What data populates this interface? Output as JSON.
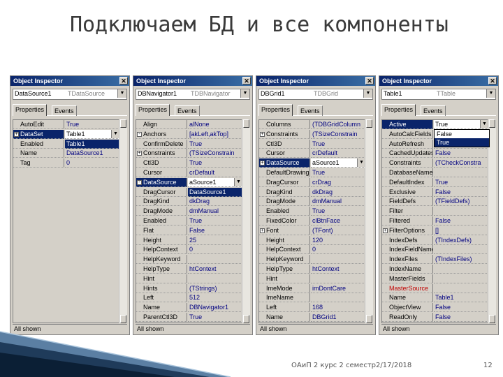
{
  "slide": {
    "title": "Подключаем БД и все компоненты",
    "footer_course": "ОАиП 2 курс 2 семестр",
    "footer_date": "2/17/2018",
    "footer_page": "12"
  },
  "inspectors": [
    {
      "title": "Object Inspector",
      "combo_name": "DataSource1",
      "combo_type": "TDataSource",
      "tab_active": "Properties",
      "tab_inactive": "Events",
      "status": "All shown",
      "rows": [
        {
          "n": "AutoEdit",
          "v": "True",
          "pm": ""
        },
        {
          "n": "DataSet",
          "v": "Table1",
          "pm": "+",
          "sel": true,
          "dd": true
        },
        {
          "n": "Enabled",
          "v": "Table1",
          "pm": "",
          "hlv": true
        },
        {
          "n": "Name",
          "v": "DataSource1",
          "pm": ""
        },
        {
          "n": "Tag",
          "v": "0",
          "pm": ""
        }
      ]
    },
    {
      "title": "Object Inspector",
      "combo_name": "DBNavigator1",
      "combo_type": "TDBNavigator",
      "tab_active": "Properties",
      "tab_inactive": "Events",
      "status": "All shown",
      "rows": [
        {
          "n": "Align",
          "v": "alNone",
          "pm": ""
        },
        {
          "n": "Anchors",
          "v": "[akLeft,akTop]",
          "pm": "-"
        },
        {
          "n": "ConfirmDelete",
          "v": "True",
          "pm": ""
        },
        {
          "n": "Constraints",
          "v": "(TSizeConstrain",
          "pm": "+"
        },
        {
          "n": "Ctl3D",
          "v": "True",
          "pm": ""
        },
        {
          "n": "Cursor",
          "v": "crDefault",
          "pm": ""
        },
        {
          "n": "DataSource",
          "v": "aSource1",
          "pm": "-",
          "sel": true,
          "dd": true
        },
        {
          "n": "DragCursor",
          "v": "DataSource1",
          "pm": "",
          "hlv": true
        },
        {
          "n": "DragKind",
          "v": "dkDrag",
          "pm": ""
        },
        {
          "n": "DragMode",
          "v": "dmManual",
          "pm": ""
        },
        {
          "n": "Enabled",
          "v": "True",
          "pm": ""
        },
        {
          "n": "Flat",
          "v": "False",
          "pm": ""
        },
        {
          "n": "Height",
          "v": "25",
          "pm": ""
        },
        {
          "n": "HelpContext",
          "v": "0",
          "pm": ""
        },
        {
          "n": "HelpKeyword",
          "v": "",
          "pm": ""
        },
        {
          "n": "HelpType",
          "v": "htContext",
          "pm": ""
        },
        {
          "n": "Hint",
          "v": "",
          "pm": ""
        },
        {
          "n": "Hints",
          "v": "(TStrings)",
          "pm": ""
        },
        {
          "n": "Left",
          "v": "512",
          "pm": ""
        },
        {
          "n": "Name",
          "v": "DBNavigator1",
          "pm": ""
        },
        {
          "n": "ParentCtl3D",
          "v": "True",
          "pm": ""
        }
      ]
    },
    {
      "title": "Object Inspector",
      "combo_name": "DBGrid1",
      "combo_type": "TDBGrid",
      "tab_active": "Properties",
      "tab_inactive": "Events",
      "status": "All shown",
      "rows": [
        {
          "n": "Columns",
          "v": "(TDBGridColumn",
          "pm": ""
        },
        {
          "n": "Constraints",
          "v": "(TSizeConstrain",
          "pm": "+"
        },
        {
          "n": "Ctl3D",
          "v": "True",
          "pm": ""
        },
        {
          "n": "Cursor",
          "v": "crDefault",
          "pm": ""
        },
        {
          "n": "DataSource",
          "v": "aSource1",
          "pm": "+",
          "sel": true,
          "dd": true
        },
        {
          "n": "DefaultDrawing",
          "v": "True",
          "pm": ""
        },
        {
          "n": "DragCursor",
          "v": "crDrag",
          "pm": ""
        },
        {
          "n": "DragKind",
          "v": "dkDrag",
          "pm": ""
        },
        {
          "n": "DragMode",
          "v": "dmManual",
          "pm": ""
        },
        {
          "n": "Enabled",
          "v": "True",
          "pm": ""
        },
        {
          "n": "FixedColor",
          "v": "clBtnFace",
          "pm": ""
        },
        {
          "n": "Font",
          "v": "(TFont)",
          "pm": "+"
        },
        {
          "n": "Height",
          "v": "120",
          "pm": ""
        },
        {
          "n": "HelpContext",
          "v": "0",
          "pm": ""
        },
        {
          "n": "HelpKeyword",
          "v": "",
          "pm": ""
        },
        {
          "n": "HelpType",
          "v": "htContext",
          "pm": ""
        },
        {
          "n": "Hint",
          "v": "",
          "pm": ""
        },
        {
          "n": "ImeMode",
          "v": "imDontCare",
          "pm": ""
        },
        {
          "n": "ImeName",
          "v": "",
          "pm": ""
        },
        {
          "n": "Left",
          "v": "168",
          "pm": ""
        },
        {
          "n": "Name",
          "v": "DBGrid1",
          "pm": ""
        }
      ]
    },
    {
      "title": "Object Inspector",
      "combo_name": "Table1",
      "combo_type": "TTable",
      "tab_active": "Properties",
      "tab_inactive": "Events",
      "status": "All shown",
      "dropdown": [
        "False",
        "True"
      ],
      "rows": [
        {
          "n": "Active",
          "v": "True",
          "pm": "",
          "sel": true,
          "dd": true
        },
        {
          "n": "AutoCalcFields",
          "v": "",
          "pm": ""
        },
        {
          "n": "AutoRefresh",
          "v": "",
          "pm": ""
        },
        {
          "n": "CachedUpdates",
          "v": "False",
          "pm": ""
        },
        {
          "n": "Constraints",
          "v": "(TCheckConstra",
          "pm": ""
        },
        {
          "n": "DatabaseName",
          "v": "",
          "pm": ""
        },
        {
          "n": "DefaultIndex",
          "v": "True",
          "pm": ""
        },
        {
          "n": "Exclusive",
          "v": "False",
          "pm": ""
        },
        {
          "n": "FieldDefs",
          "v": "(TFieldDefs)",
          "pm": ""
        },
        {
          "n": "Filter",
          "v": "",
          "pm": ""
        },
        {
          "n": "Filtered",
          "v": "False",
          "pm": ""
        },
        {
          "n": "FilterOptions",
          "v": "[]",
          "pm": "+"
        },
        {
          "n": "IndexDefs",
          "v": "(TIndexDefs)",
          "pm": ""
        },
        {
          "n": "IndexFieldNames",
          "v": "",
          "pm": ""
        },
        {
          "n": "IndexFiles",
          "v": "(TIndexFiles)",
          "pm": ""
        },
        {
          "n": "IndexName",
          "v": "",
          "pm": ""
        },
        {
          "n": "MasterFields",
          "v": "",
          "pm": ""
        },
        {
          "n": "MasterSource",
          "v": "",
          "pm": "",
          "red": true
        },
        {
          "n": "Name",
          "v": "Table1",
          "pm": ""
        },
        {
          "n": "ObjectView",
          "v": "False",
          "pm": ""
        },
        {
          "n": "ReadOnly",
          "v": "False",
          "pm": ""
        }
      ]
    }
  ]
}
